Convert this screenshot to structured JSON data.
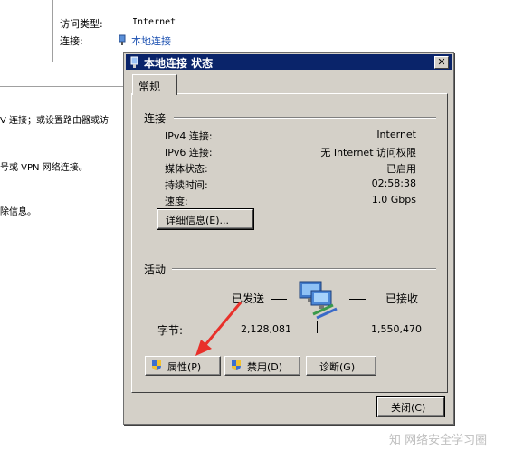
{
  "background": {
    "access_type_label": "访问类型:",
    "access_type_value": "Internet",
    "connections_label": "连接:",
    "connections_value": "本地连接",
    "text_line1": "V 连接；或设置路由器或访",
    "text_line2": "号或 VPN 网络连接。",
    "text_line3": "除信息。"
  },
  "dialog": {
    "title": "本地连接 状态",
    "close_glyph": "✕",
    "tab": "常规",
    "connection_group": "连接",
    "rows": [
      {
        "label": "IPv4 连接:",
        "value": "Internet"
      },
      {
        "label": "IPv6 连接:",
        "value": "无 Internet 访问权限"
      },
      {
        "label": "媒体状态:",
        "value": "已启用"
      },
      {
        "label": "持续时间:",
        "value": "02:58:38"
      },
      {
        "label": "速度:",
        "value": "1.0 Gbps"
      }
    ],
    "details_button": "详细信息(E)...",
    "activity_group": "活动",
    "sent_label": "已发送",
    "received_label": "已接收",
    "bytes_label": "字节:",
    "bytes_sent": "2,128,081",
    "bytes_received": "1,550,470",
    "properties_button": "属性(P)",
    "disable_button": "禁用(D)",
    "diagnose_button": "诊断(G)",
    "close_button": "关闭(C)"
  },
  "watermark": "知 网络安全学习圈",
  "colors": {
    "titlebar": "#0a246a",
    "dialog_bg": "#d4d0c8",
    "arrow": "#e8302a"
  }
}
